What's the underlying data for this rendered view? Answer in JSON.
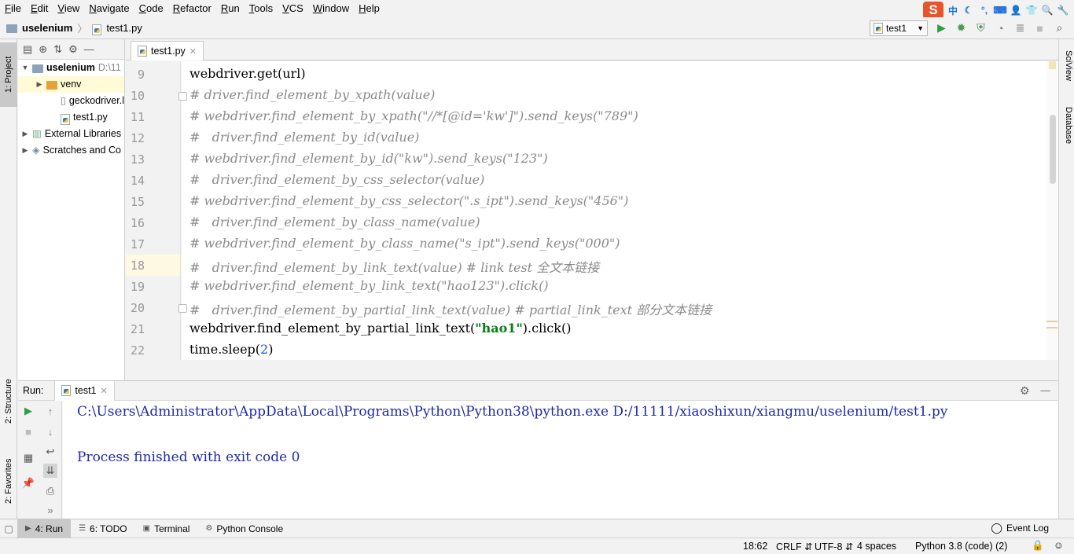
{
  "menu": [
    "File",
    "Edit",
    "View",
    "Navigate",
    "Code",
    "Refactor",
    "Run",
    "Tools",
    "VCS",
    "Window",
    "Help"
  ],
  "tray": {
    "sogou": "S",
    "ime": "中"
  },
  "breadcrumb": {
    "project": "uselenium",
    "file": "test1.py"
  },
  "run_config": {
    "label": "test1"
  },
  "left_tabs": {
    "project": "1: Project",
    "structure": "2: Structure",
    "favorites": "2: Favorites"
  },
  "right_tabs": {
    "sciview": "SciView",
    "database": "Database"
  },
  "project_tree": [
    {
      "label": "uselenium",
      "suffix": "D:\\11",
      "indent": 0,
      "kind": "folder",
      "open": true
    },
    {
      "label": "venv",
      "indent": 1,
      "kind": "folder-orange",
      "open": false
    },
    {
      "label": "geckodriver.l",
      "indent": 2,
      "kind": "file"
    },
    {
      "label": "test1.py",
      "indent": 2,
      "kind": "py"
    },
    {
      "label": "External Libraries",
      "indent": 0,
      "kind": "lib",
      "open": false
    },
    {
      "label": "Scratches and Co",
      "indent": 0,
      "kind": "scratch",
      "open": false
    }
  ],
  "editor": {
    "tab": "test1.py",
    "lines": [
      {
        "n": "9",
        "parts": [
          [
            "",
            "webdriver.get(url)"
          ]
        ]
      },
      {
        "n": "10",
        "parts": [
          [
            "cm",
            "# driver.find_element_by_xpath(value)"
          ]
        ],
        "fold": true
      },
      {
        "n": "11",
        "parts": [
          [
            "cm",
            "# webdriver.find_element_by_xpath(\"//*[@id='kw']\").send_keys(\"789\")"
          ]
        ]
      },
      {
        "n": "12",
        "parts": [
          [
            "cm",
            "#   driver.find_element_by_id(value)"
          ]
        ]
      },
      {
        "n": "13",
        "parts": [
          [
            "cm",
            "# webdriver.find_element_by_id(\"kw\").send_keys(\"123\")"
          ]
        ]
      },
      {
        "n": "14",
        "parts": [
          [
            "cm",
            "#   driver.find_element_by_css_selector(value)"
          ]
        ]
      },
      {
        "n": "15",
        "parts": [
          [
            "cm",
            "# webdriver.find_element_by_css_selector(\".s_ipt\").send_keys(\"456\")"
          ]
        ]
      },
      {
        "n": "16",
        "parts": [
          [
            "cm",
            "#   driver.find_element_by_class_name(value)"
          ]
        ]
      },
      {
        "n": "17",
        "parts": [
          [
            "cm",
            "# webdriver.find_element_by_class_name(\"s_ipt\").send_keys(\"000\")"
          ]
        ]
      },
      {
        "n": "18",
        "parts": [
          [
            "cm",
            "#   driver.find_element_by_link_text(value) # link test 全文本链接"
          ]
        ],
        "highlight": true
      },
      {
        "n": "19",
        "parts": [
          [
            "cm",
            "# webdriver.find_element_by_link_text(\"hao123\").click()"
          ]
        ]
      },
      {
        "n": "20",
        "parts": [
          [
            "cm",
            "#   driver.find_element_by_partial_link_text(value) # partial_link_text 部分文本链接"
          ]
        ],
        "fold": true
      },
      {
        "n": "21",
        "parts": [
          [
            "",
            "webdriver.find_element_by_partial_link_text("
          ],
          [
            "str",
            "\"hao1\""
          ],
          [
            "",
            ").click()"
          ]
        ]
      },
      {
        "n": "22",
        "parts": [
          [
            "",
            "time.sleep("
          ],
          [
            "num",
            "2"
          ],
          [
            "",
            ")"
          ]
        ]
      }
    ]
  },
  "run_panel": {
    "label": "Run:",
    "tab": "test1",
    "console": [
      "C:\\Users\\Administrator\\AppData\\Local\\Programs\\Python\\Python38\\python.exe D:/11111/xiaoshixun/xiangmu/uselenium/test1.py",
      "",
      "Process finished with exit code 0"
    ]
  },
  "bottom_tabs": [
    {
      "label": "4: Run",
      "active": true
    },
    {
      "label": "6: TODO",
      "active": false
    },
    {
      "label": "Terminal",
      "active": false
    },
    {
      "label": "Python Console",
      "active": false
    }
  ],
  "event_log": "Event Log",
  "status": {
    "position": "18:62",
    "line_sep": "CRLF",
    "encoding": "UTF-8",
    "indent": "4 spaces",
    "interpreter": "Python 3.8 (code) (2)"
  }
}
